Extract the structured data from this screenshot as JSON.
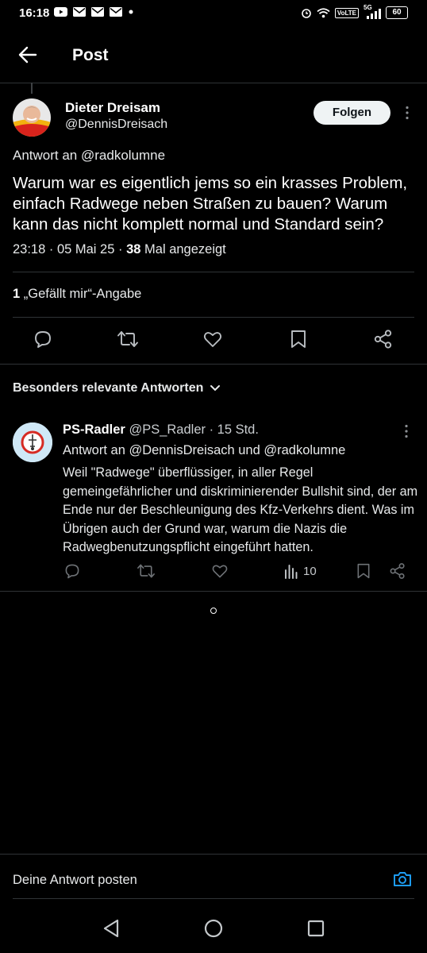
{
  "status_bar": {
    "time": "16:18",
    "network": "5G",
    "volte": "VoLTE",
    "battery": "60",
    "left_icons": [
      "youtube-icon",
      "mail-icon",
      "mail-icon",
      "mail-icon",
      "dot-icon"
    ]
  },
  "header": {
    "title": "Post",
    "back_icon": "arrow-left-icon"
  },
  "tweet": {
    "author_name": "Dieter Dreisam",
    "author_handle": "@DennisDreisach",
    "follow_label": "Folgen",
    "reply_to": "Antwort an @radkolumne",
    "text": "Warum war es eigentlich jems so ein krasses Problem, einfach Radwege neben Straßen zu bauen? Warum kann das nicht komplett normal und Standard sein?",
    "time_date": "23:18 · 05 Mai 25 · ",
    "views_count": "38",
    "views_label": " Mal angezeigt",
    "likes_count": "1",
    "likes_label": " „Gefällt mir“-Angabe"
  },
  "section": {
    "title": "Besonders relevante Antworten"
  },
  "reply": {
    "name": "PS-Radler",
    "handle_time": " @PS_Radler · 15 Std.",
    "reply_to": "Antwort an @DennisDreisach und @radkolumne",
    "text": "Weil \"Radwege\" überflüssiger, in aller Regel gemeingefährlicher und diskriminierender Bullshit sind, der am Ende nur der Beschleunigung des Kfz-Verkehrs dient. Was im Übrigen auch der Grund war, warum die Nazis die Radwegbenutzungspflicht eingeführt hatten.",
    "views": "10"
  },
  "compose": {
    "placeholder": "Deine Antwort posten"
  },
  "colors": {
    "background": "#000000",
    "divider": "#2f3336",
    "accent": "#1d9bf0",
    "text": "#e7e9ea"
  }
}
